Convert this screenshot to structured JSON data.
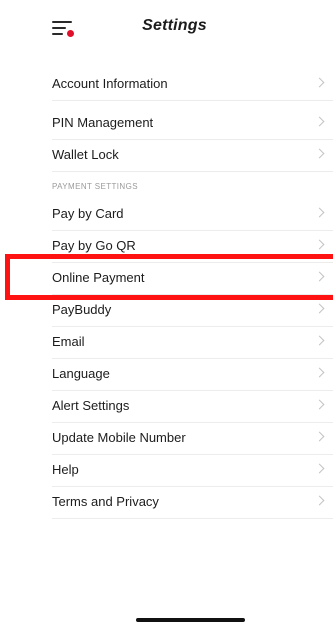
{
  "header": {
    "title": "Settings",
    "menu_icon": "hamburger-menu-with-notification-dot-icon",
    "accent_color": "#e0102a"
  },
  "sections": {
    "payment_settings_label": "PAYMENT SETTINGS"
  },
  "items": [
    {
      "label": "Account Information"
    },
    {
      "label": "PIN Management"
    },
    {
      "label": "Wallet Lock"
    },
    {
      "label": "Pay by Card"
    },
    {
      "label": "Pay by Go QR"
    },
    {
      "label": "Online Payment"
    },
    {
      "label": "PayBuddy"
    },
    {
      "label": "Email"
    },
    {
      "label": "Language"
    },
    {
      "label": "Alert Settings"
    },
    {
      "label": "Update Mobile Number"
    },
    {
      "label": "Help"
    },
    {
      "label": "Terms and Privacy"
    }
  ],
  "highlighted_item": "Online Payment",
  "highlight_color": "#ff1212",
  "chevron_icon": "chevron-right-icon"
}
